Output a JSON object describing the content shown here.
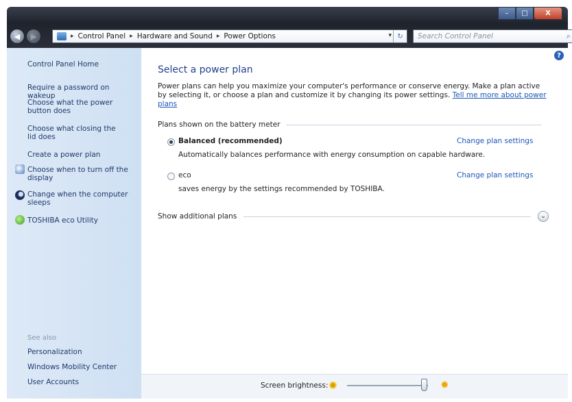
{
  "window": {
    "caption_min": "–",
    "caption_max": "□",
    "caption_close": "X"
  },
  "navbar": {
    "back_glyph": "◀",
    "forward_glyph": "▶",
    "breadcrumb": [
      "Control Panel",
      "Hardware and Sound",
      "Power Options"
    ],
    "breadcrumb_sep": "▸",
    "refresh_glyph": "↻",
    "search_placeholder": "Search Control Panel"
  },
  "sidebar": {
    "home": "Control Panel Home",
    "links": [
      "Require a password on wakeup",
      "Choose what the power button does",
      "Choose what closing the lid does",
      "Create a power plan"
    ],
    "icon_links": [
      {
        "label": "Choose when to turn off the display",
        "icon": "display-icon"
      },
      {
        "label": "Change when the computer sleeps",
        "icon": "moon-icon"
      },
      {
        "label": "TOSHIBA eco Utility",
        "icon": "eco-leaf-icon"
      }
    ],
    "see_also": "See also",
    "see_also_links": [
      "Personalization",
      "Windows Mobility Center",
      "User Accounts"
    ]
  },
  "main": {
    "title": "Select a power plan",
    "intro": "Power plans can help you maximize your computer's performance or conserve energy. Make a plan active by selecting it, or choose a plan and customize it by changing its power settings.",
    "intro_link": "Tell me more about power plans",
    "group_header": "Plans shown on the battery meter",
    "plans": [
      {
        "name": "Balanced (recommended)",
        "desc": "Automatically balances performance with energy consumption on capable hardware.",
        "link": "Change plan settings",
        "selected": true
      },
      {
        "name": "eco",
        "desc": "saves energy by the settings recommended by TOSHIBA.",
        "link": "Change plan settings",
        "selected": false
      }
    ],
    "show_additional": "Show additional plans",
    "help_glyph": "?"
  },
  "bottom": {
    "brightness_label": "Screen brightness:",
    "brightness_level": 0.95
  },
  "colors": {
    "sidebar_bg": "#d4e3f5",
    "link": "#1b56b8",
    "title": "#1f3f8a"
  }
}
